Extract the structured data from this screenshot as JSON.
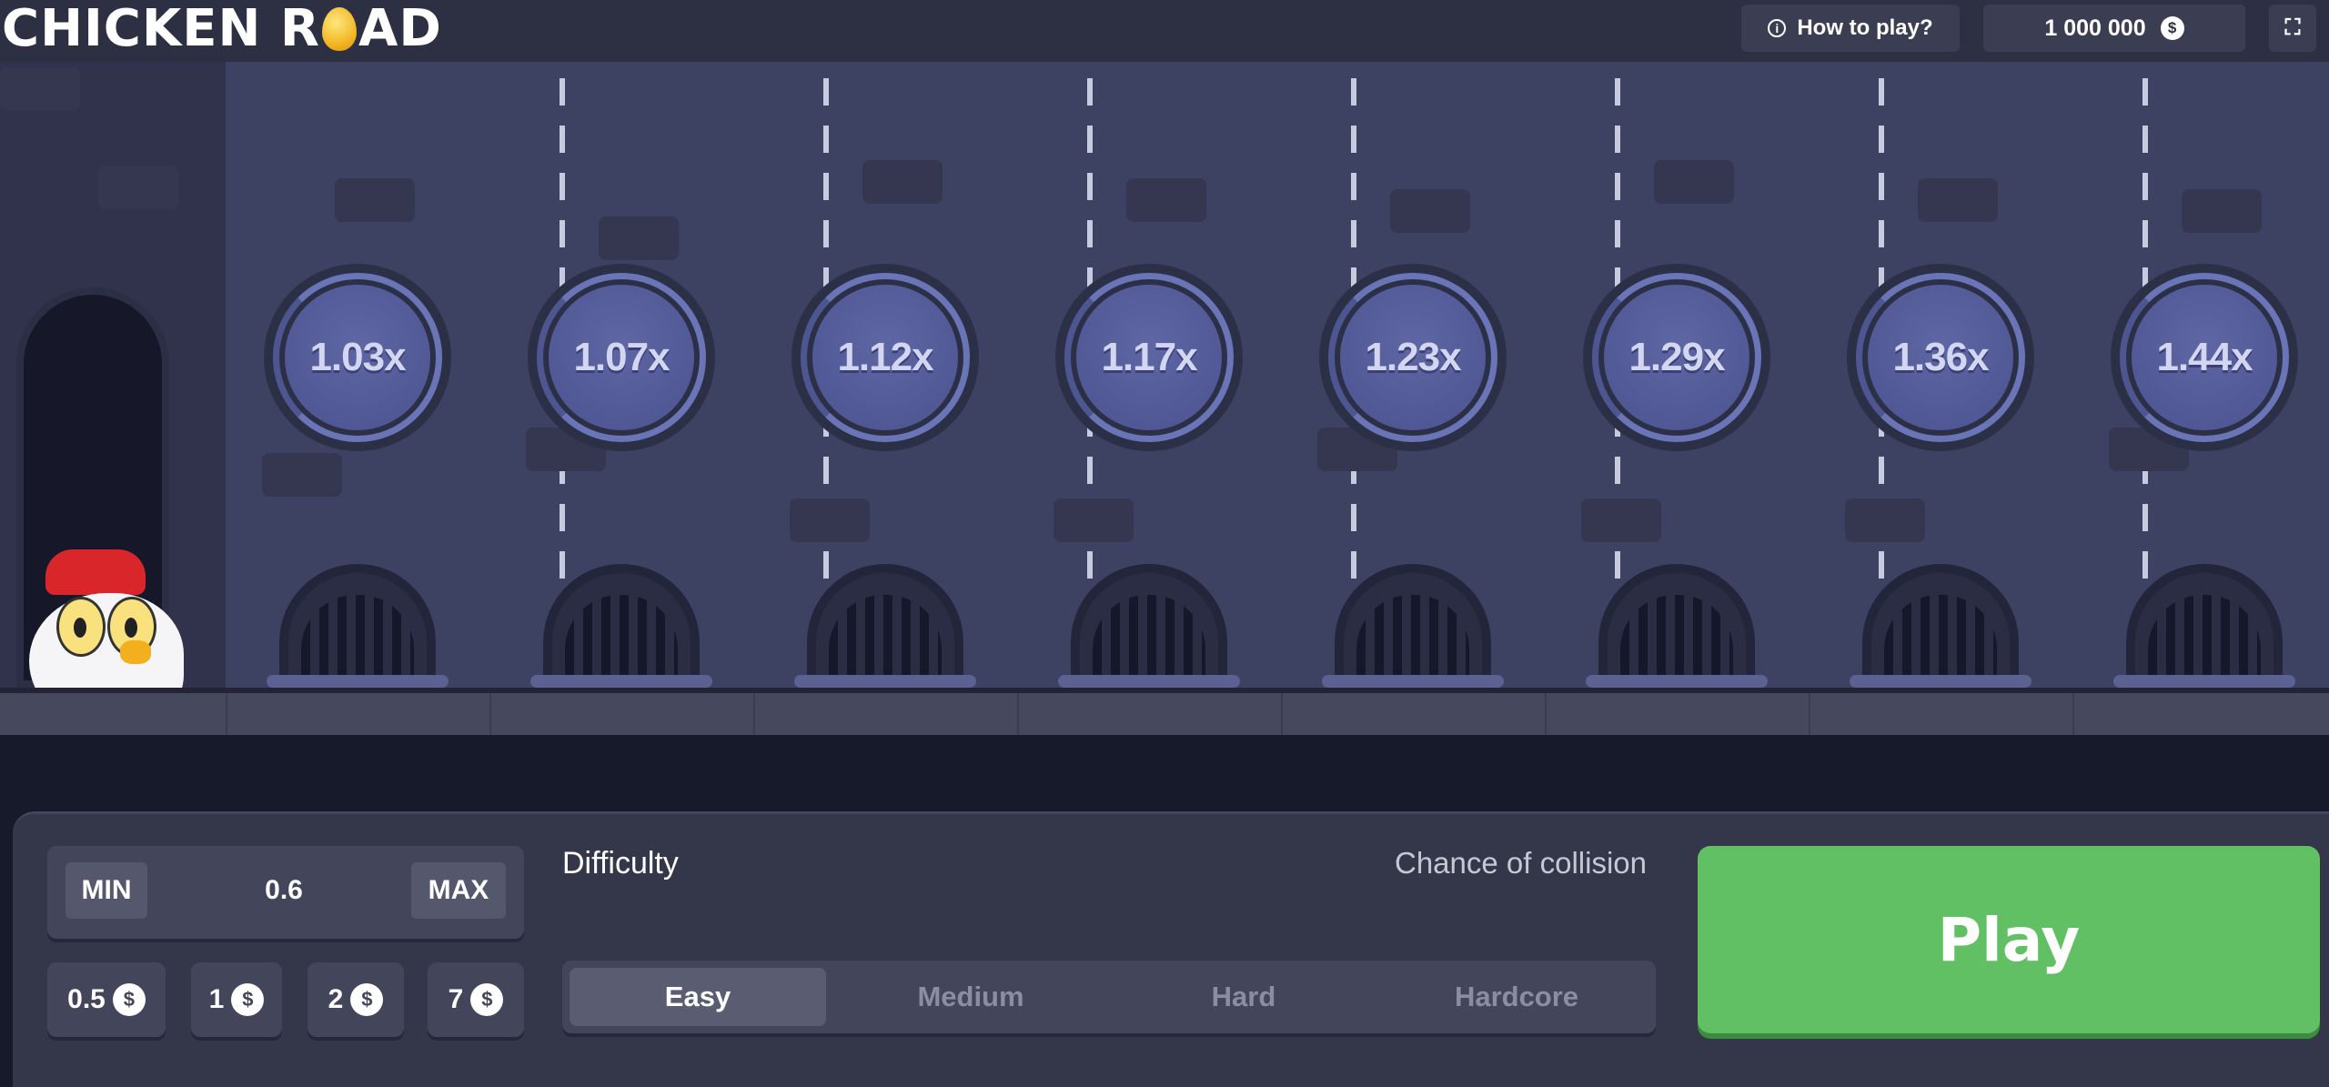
{
  "header": {
    "logo_part1": "CHICKEN R",
    "logo_part2": "AD",
    "how_to_play": "How to play?",
    "balance": "1 000 000",
    "currency_symbol": "$"
  },
  "lanes": {
    "multipliers": [
      "1.03x",
      "1.07x",
      "1.12x",
      "1.17x",
      "1.23x",
      "1.29x",
      "1.36x",
      "1.44x"
    ]
  },
  "controls": {
    "min_label": "MIN",
    "max_label": "MAX",
    "bet_value": "0.6",
    "quick_bets": [
      "0.5",
      "1",
      "2",
      "7"
    ],
    "difficulty_label": "Difficulty",
    "chance_label": "Chance of collision",
    "difficulties": [
      "Easy",
      "Medium",
      "Hard",
      "Hardcore"
    ],
    "selected_difficulty": "Easy",
    "play_label": "Play"
  },
  "colors": {
    "play_button": "#62c064",
    "road": "#3e4262",
    "multiplier_ring": "#6a75b8"
  }
}
